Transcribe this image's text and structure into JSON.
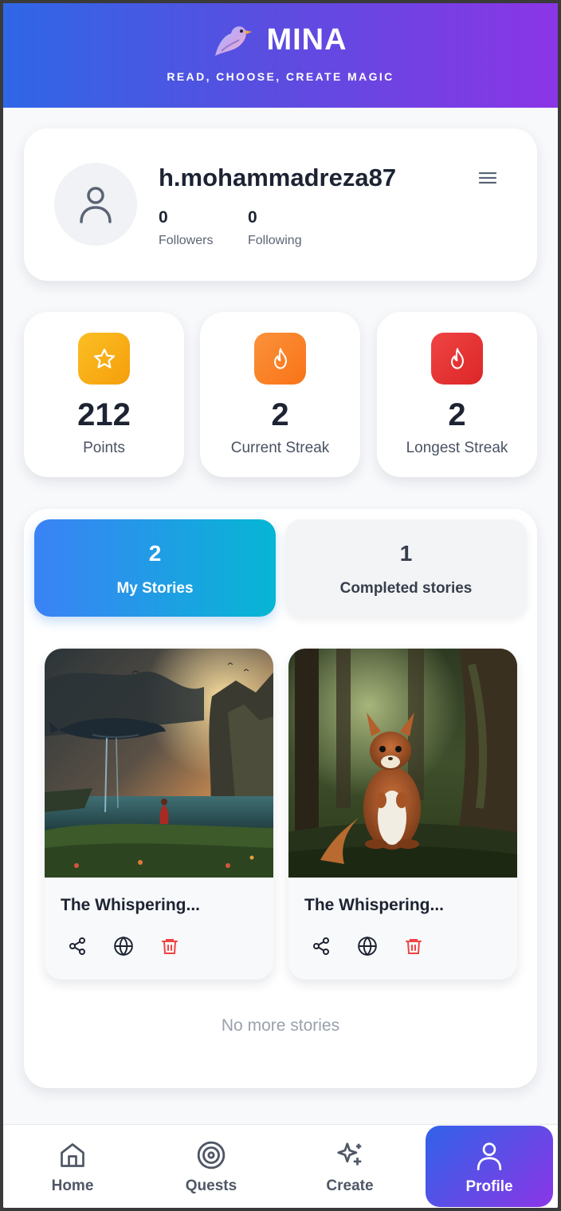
{
  "app": {
    "name": "MINA",
    "tagline": "READ, CHOOSE, CREATE MAGIC",
    "logo_icon": "bird-icon",
    "header_gradient": [
      "#2f67e6",
      "#8b35e6"
    ]
  },
  "profile": {
    "username": "h.mohammadreza87",
    "avatar_icon": "user-icon",
    "followers_count": "0",
    "followers_label": "Followers",
    "following_count": "0",
    "following_label": "Following",
    "menu_icon": "hamburger-menu-icon"
  },
  "stats": [
    {
      "value": "212",
      "label": "Points",
      "icon": "star-icon",
      "color": "#f59e0b"
    },
    {
      "value": "2",
      "label": "Current Streak",
      "icon": "flame-icon",
      "color": "#f97316"
    },
    {
      "value": "2",
      "label": "Longest Streak",
      "icon": "flame-icon",
      "color": "#dc2626"
    }
  ],
  "tabs": [
    {
      "count": "2",
      "label": "My Stories",
      "active": true
    },
    {
      "count": "1",
      "label": "Completed stories",
      "active": false
    }
  ],
  "stories": [
    {
      "title": "The Whispering...",
      "image": "flying-whale-over-lake-at-sunset",
      "actions": [
        "share-icon",
        "globe-icon",
        "trash-icon"
      ]
    },
    {
      "title": "The Whispering...",
      "image": "squirrel-in-forest",
      "actions": [
        "share-icon",
        "globe-icon",
        "trash-icon"
      ]
    }
  ],
  "stories_footer": "No more stories",
  "nav": {
    "items": [
      {
        "label": "Home",
        "icon": "home-icon",
        "active": false
      },
      {
        "label": "Quests",
        "icon": "target-icon",
        "active": false
      },
      {
        "label": "Create",
        "icon": "sparkles-icon",
        "active": false
      },
      {
        "label": "Profile",
        "icon": "user-icon",
        "active": true
      }
    ]
  },
  "colors": {
    "accent_blue": "#3b82f6",
    "accent_cyan": "#06b6d4",
    "accent_purple": "#8b36e6",
    "danger": "#ef4444"
  }
}
